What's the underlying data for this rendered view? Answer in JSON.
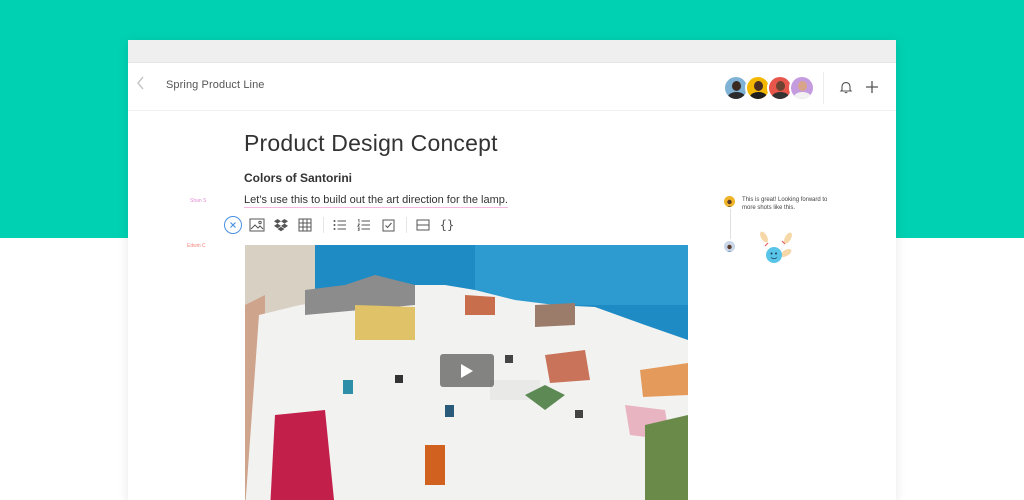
{
  "header": {
    "doc_title": "Spring Product Line"
  },
  "document": {
    "title": "Product Design Concept",
    "section_heading": "Colors of Santorini",
    "body_text": "Let’s use this to build out the art direction for the lamp.",
    "authors": [
      "Shan S",
      "Edwin C"
    ]
  },
  "comments": [
    {
      "text": "This is great!  Looking forward to more shots like this."
    }
  ],
  "toolbar": {
    "braces_label": "{}"
  },
  "colors": {
    "brand_teal": "#00d1b2",
    "accent_blue": "#4a90e2"
  },
  "icons": [
    "chevron-left-icon",
    "bell-icon",
    "plus-icon",
    "close-icon",
    "image-icon",
    "dropbox-icon",
    "table-icon",
    "bulleted-list-icon",
    "numbered-list-icon",
    "checkbox-icon",
    "divider-icon",
    "code-block-icon",
    "play-icon"
  ]
}
